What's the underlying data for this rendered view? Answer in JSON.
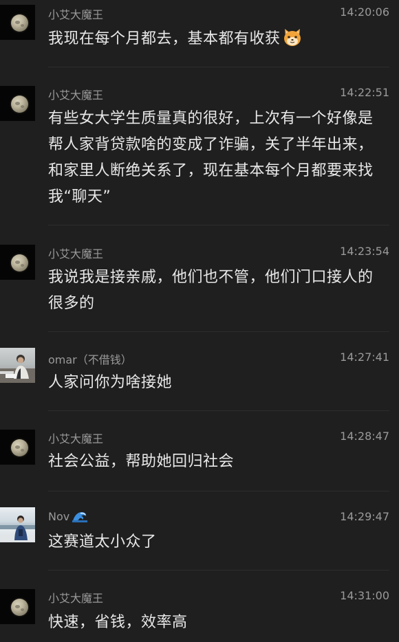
{
  "messages": [
    {
      "sender": "小艾大魔王",
      "time": "14:20:06",
      "text": "我现在每个月都去，基本都有收获",
      "avatar": "moon-avatar"
    },
    {
      "sender": "小艾大魔王",
      "time": "14:22:51",
      "text": "有些女大学生质量真的很好，上次有一个好像是帮人家背贷款啥的变成了诈骗，关了半年出来，和家里人断绝关系了，现在基本每个月都要来找我“聊天”",
      "avatar": "moon-avatar"
    },
    {
      "sender": "小艾大魔王",
      "time": "14:23:54",
      "text": "我说我是接亲戚，他们也不管，他们门口接人的很多的",
      "avatar": "moon-avatar"
    },
    {
      "sender": "omar（不借钱）",
      "time": "14:27:41",
      "text": "人家问你为啥接她",
      "avatar": "photo-avatar"
    },
    {
      "sender": "小艾大魔王",
      "time": "14:28:47",
      "text": "社会公益，帮助她回归社会",
      "avatar": "moon-avatar"
    },
    {
      "sender": "Nov",
      "time": "14:29:47",
      "text": "这赛道太小众了",
      "avatar": "photo-avatar",
      "name_icon": "wave-icon"
    },
    {
      "sender": "小艾大魔王",
      "time": "14:31:00",
      "text": "快速，省钱，效率高",
      "avatar": "moon-avatar"
    }
  ],
  "inline_icons": {
    "message_1": "cat-face-emoji"
  },
  "colors": {
    "background": "#1f1f1f",
    "meta_text": "#9a9a9a",
    "message_text": "#e8e8e8",
    "divider": "#2d2d2d"
  }
}
